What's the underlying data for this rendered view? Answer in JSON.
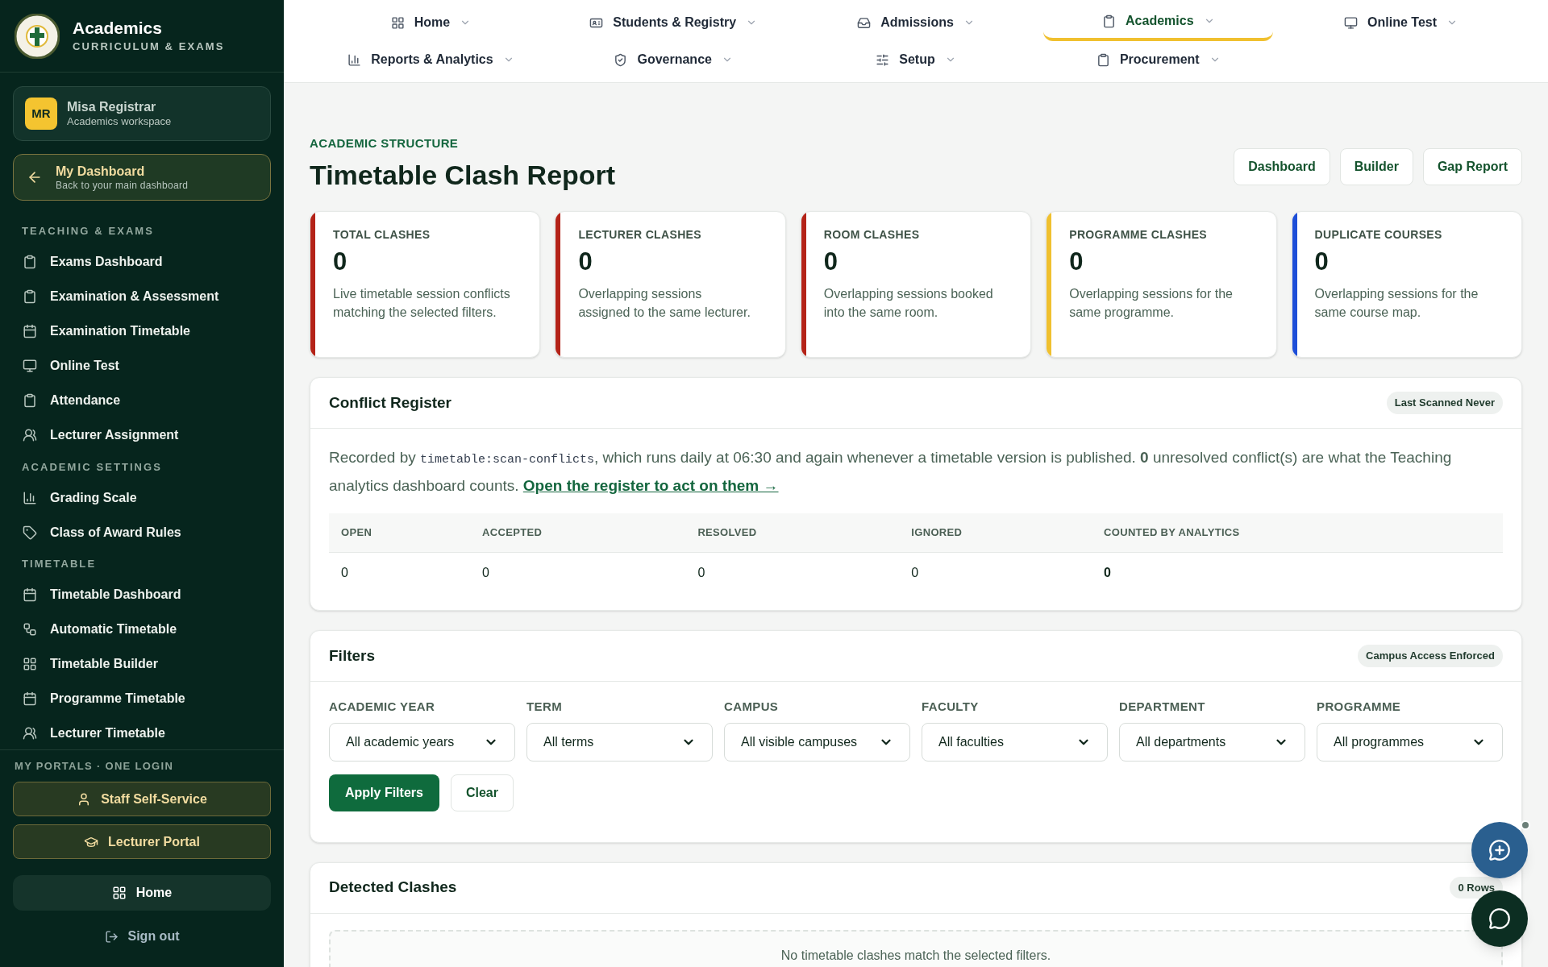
{
  "sidebar": {
    "brand": {
      "title": "Academics",
      "subtitle": "CURRICULUM & EXAMS"
    },
    "user": {
      "initials": "MR",
      "name": "Misa Registrar",
      "role": "Academics workspace"
    },
    "back": {
      "title": "My Dashboard",
      "subtitle": "Back to your main dashboard"
    },
    "sections": [
      {
        "title": "TEACHING & EXAMS",
        "items": [
          "Exams Dashboard",
          "Examination & Assessment",
          "Examination Timetable",
          "Online Test",
          "Attendance",
          "Lecturer Assignment"
        ]
      },
      {
        "title": "ACADEMIC SETTINGS",
        "items": [
          "Grading Scale",
          "Class of Award Rules"
        ]
      },
      {
        "title": "TIMETABLE",
        "items": [
          "Timetable Dashboard",
          "Automatic Timetable",
          "Timetable Builder",
          "Programme Timetable",
          "Lecturer Timetable"
        ]
      }
    ],
    "portals_title": "MY PORTALS · ONE LOGIN",
    "portals": [
      "Staff Self-Service",
      "Lecturer Portal"
    ],
    "home": "Home",
    "sign_out": "Sign out"
  },
  "topnav": [
    {
      "label": "Home",
      "selected": false
    },
    {
      "label": "Students & Registry",
      "selected": false
    },
    {
      "label": "Admissions",
      "selected": false
    },
    {
      "label": "Academics",
      "selected": true
    },
    {
      "label": "Online Test",
      "selected": false
    },
    {
      "label": "Reports & Analytics",
      "selected": false
    },
    {
      "label": "Governance",
      "selected": false
    },
    {
      "label": "Setup",
      "selected": false
    },
    {
      "label": "Procurement",
      "selected": false
    }
  ],
  "page": {
    "eyebrow": "ACADEMIC STRUCTURE",
    "title": "Timetable Clash Report",
    "actions": [
      "Dashboard",
      "Builder",
      "Gap Report"
    ]
  },
  "cards": [
    {
      "label": "TOTAL CLASHES",
      "value": "0",
      "note": "Live timetable session conflicts matching the selected filters.",
      "color": "#b42318"
    },
    {
      "label": "LECTURER CLASHES",
      "value": "0",
      "note": "Overlapping sessions assigned to the same lecturer.",
      "color": "#b42318"
    },
    {
      "label": "ROOM CLASHES",
      "value": "0",
      "note": "Overlapping sessions booked into the same room.",
      "color": "#b42318"
    },
    {
      "label": "PROGRAMME CLASHES",
      "value": "0",
      "note": "Overlapping sessions for the same programme.",
      "color": "#f0c02f"
    },
    {
      "label": "DUPLICATE COURSES",
      "value": "0",
      "note": "Overlapping sessions for the same course map.",
      "color": "#1d4ed8"
    }
  ],
  "register": {
    "title": "Conflict Register",
    "badge": "Last Scanned Never",
    "lead": "Recorded by ",
    "code": "timetable:scan-conflicts",
    "text": ", which runs daily at 06:30 and again whenever a timetable version is published. **0** unresolved conflict(s) are what the Teaching analytics dashboard counts. ",
    "link": "Open the register to act on them →",
    "columns": [
      {
        "label": "OPEN",
        "bold": false
      },
      {
        "label": "ACCEPTED",
        "bold": false
      },
      {
        "label": "RESOLVED",
        "bold": false
      },
      {
        "label": "IGNORED",
        "bold": false
      },
      {
        "label": "COUNTED BY ANALYTICS",
        "bold": true
      }
    ],
    "rows": [
      [
        "0",
        "0",
        "0",
        "0",
        "0"
      ]
    ]
  },
  "filters": {
    "title": "Filters",
    "badge": "Campus Access Enforced",
    "fields": [
      {
        "label": "ACADEMIC YEAR",
        "value": "All academic years"
      },
      {
        "label": "TERM",
        "value": "All terms"
      },
      {
        "label": "CAMPUS",
        "value": "All visible campuses"
      },
      {
        "label": "FACULTY",
        "value": "All faculties"
      },
      {
        "label": "DEPARTMENT",
        "value": "All departments"
      },
      {
        "label": "PROGRAMME",
        "value": "All programmes"
      }
    ],
    "apply": "Apply Filters",
    "clear": "Clear"
  },
  "clashes": {
    "title": "Detected Clashes",
    "badge": "0 Rows",
    "empty": "No timetable clashes match the selected filters."
  }
}
